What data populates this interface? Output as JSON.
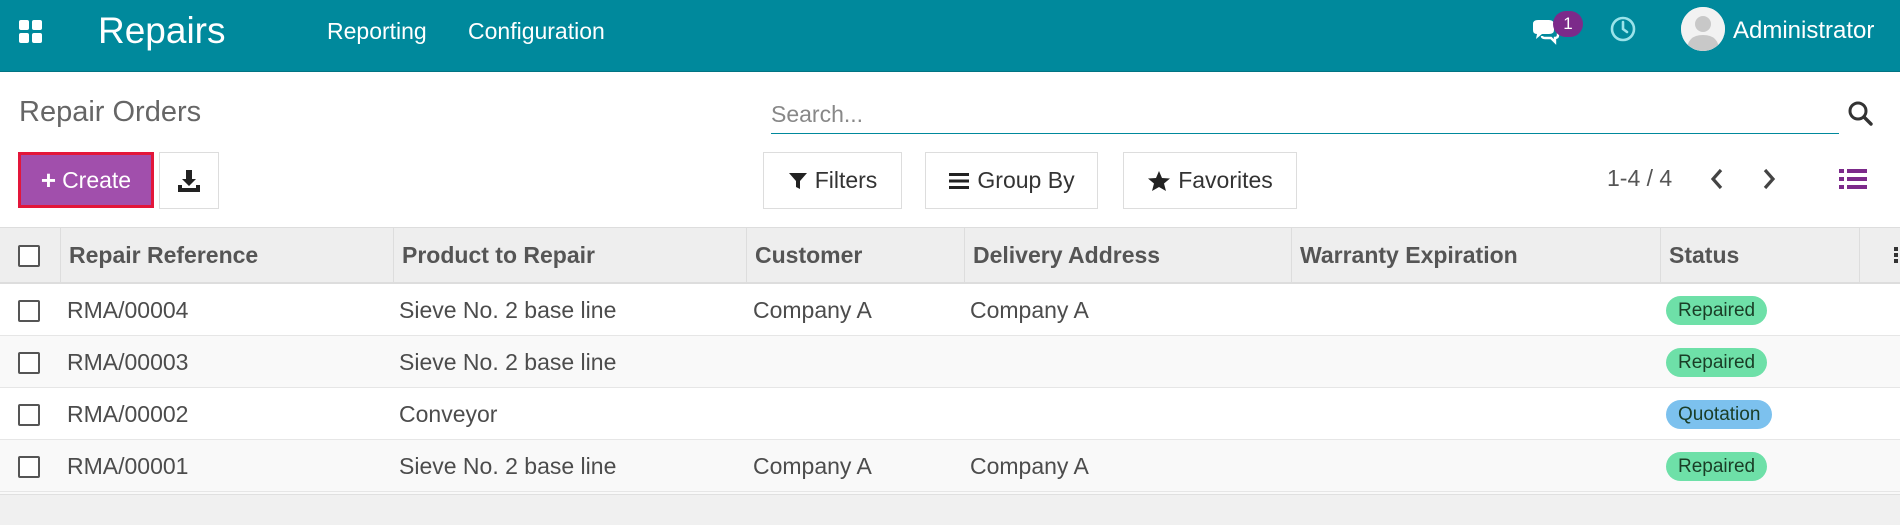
{
  "navbar": {
    "app_name": "Repairs",
    "menu": [
      "Reporting",
      "Configuration"
    ],
    "message_count": "1",
    "user_name": "Administrator",
    "bg_color": "#00899c"
  },
  "control_panel": {
    "title": "Repair Orders",
    "search_placeholder": "Search...",
    "create_label": "Create",
    "filters_label": "Filters",
    "group_by_label": "Group By",
    "favorites_label": "Favorites",
    "pager": "1-4 / 4"
  },
  "table": {
    "columns": [
      "Repair Reference",
      "Product to Repair",
      "Customer",
      "Delivery Address",
      "Warranty Expiration",
      "Status"
    ],
    "rows": [
      {
        "reference": "RMA/00004",
        "product": "Sieve No. 2 base line",
        "customer": "Company A",
        "delivery": "Company A",
        "warranty": "",
        "status": "Repaired"
      },
      {
        "reference": "RMA/00003",
        "product": "Sieve No. 2 base line",
        "customer": "",
        "delivery": "",
        "warranty": "",
        "status": "Repaired"
      },
      {
        "reference": "RMA/00002",
        "product": "Conveyor",
        "customer": "",
        "delivery": "",
        "warranty": "",
        "status": "Quotation"
      },
      {
        "reference": "RMA/00001",
        "product": "Sieve No. 2 base line",
        "customer": "Company A",
        "delivery": "Company A",
        "warranty": "",
        "status": "Repaired"
      }
    ]
  },
  "colors": {
    "accent": "#00899c",
    "create_button": "#a14fac",
    "status_repaired": "#6ee0a8",
    "status_quotation": "#7cc1ee",
    "message_badge": "#7c2a8a"
  },
  "icons": [
    "apps-grid-icon",
    "chat-icon",
    "clock-icon",
    "avatar-icon",
    "search-icon",
    "plus-icon",
    "download-icon",
    "filter-icon",
    "group-by-icon",
    "star-icon",
    "chevron-left-icon",
    "chevron-right-icon",
    "list-view-icon"
  ]
}
